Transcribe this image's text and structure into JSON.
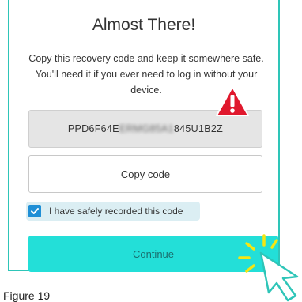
{
  "dialog": {
    "title": "Almost There!",
    "description": "Copy this recovery code and keep it somewhere safe. You'll need it if you ever need to log in without your device.",
    "code_prefix": "PPD6F64E",
    "code_masked": "ERMG85A1",
    "code_suffix": "845U1B2Z",
    "copy_label": "Copy code",
    "checkbox_label": "I have safely recorded this code",
    "checkbox_checked": true,
    "continue_label": "Continue"
  },
  "caption": "Figure 19",
  "colors": {
    "accent": "#2ec5b8",
    "continue_bg": "#23dfd8",
    "checkbox": "#1f8fd6",
    "warning": "#e0182d"
  },
  "icons": {
    "warning": "warning-icon",
    "checkmark": "checkmark-icon",
    "cursor": "pointer-cursor-icon"
  }
}
